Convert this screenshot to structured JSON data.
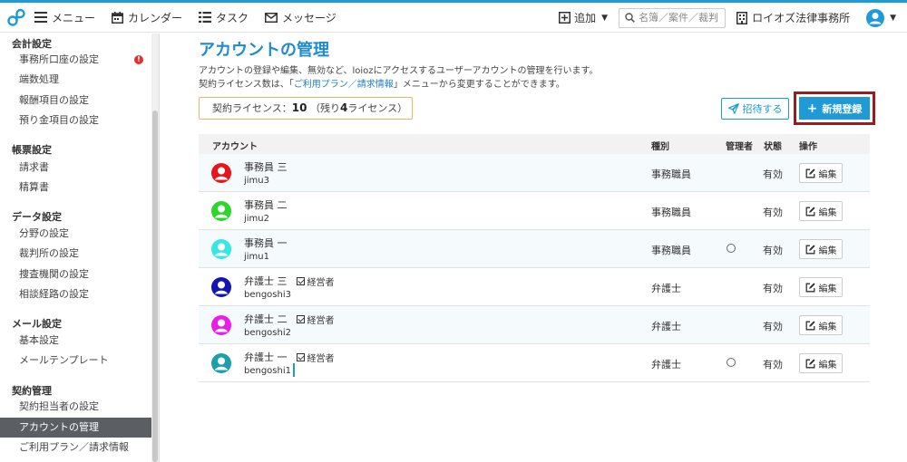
{
  "header": {
    "nav": [
      {
        "label": "メニュー",
        "icon": "hamburger-icon"
      },
      {
        "label": "カレンダー",
        "icon": "calendar-icon"
      },
      {
        "label": "タスク",
        "icon": "list-icon"
      },
      {
        "label": "メッセージ",
        "icon": "mail-icon"
      }
    ],
    "add_label": "追加",
    "search_placeholder": "名簿／案件／裁判",
    "office_name": "ロイオズ法律事務所"
  },
  "sidebar": {
    "groups": [
      {
        "heading": "会計設定",
        "items": [
          "事務所口座の設定",
          "端数処理",
          "報酬項目の設定",
          "預り金項目の設定"
        ]
      },
      {
        "heading": "帳票設定",
        "items": [
          "請求書",
          "精算書"
        ]
      },
      {
        "heading": "データ設定",
        "items": [
          "分野の設定",
          "裁判所の設定",
          "捜査機関の設定",
          "相談経路の設定"
        ]
      },
      {
        "heading": "メール設定",
        "items": [
          "基本設定",
          "メールテンプレート"
        ]
      },
      {
        "heading": "契約管理",
        "items": [
          "契約担当者の設定",
          "アカウントの管理",
          "ご利用プラン／請求情報"
        ]
      }
    ],
    "badge": "!"
  },
  "main": {
    "title": "アカウントの管理",
    "desc_line1": "アカウントの登録や編集、無効など、loiozにアクセスするユーザーアカウントの管理を行います。",
    "desc_line2_pre": "契約ライセンス数は、「",
    "desc_line2_link": "ご利用プラン／請求情報",
    "desc_line2_post": "」メニューから変更することができます。",
    "license_label": "契約ライセンス：",
    "license_count": "10",
    "license_remaining_pre": "（残り",
    "license_remaining": "4",
    "license_remaining_post": "ライセンス）",
    "invite_label": "招待する",
    "new_label": "新規登録"
  },
  "table": {
    "columns": [
      "アカウント",
      "種別",
      "管理者",
      "状態",
      "操作"
    ],
    "owner_label": "経営者",
    "edit_label": "編集",
    "rows": [
      {
        "name": "事務員 三",
        "login": "jimu3",
        "kind": "事務職員",
        "admin": false,
        "owner": false,
        "status": "有効",
        "color": "#e8141c"
      },
      {
        "name": "事務員 二",
        "login": "jimu2",
        "kind": "事務職員",
        "admin": false,
        "owner": false,
        "status": "有効",
        "color": "#2ed52a"
      },
      {
        "name": "事務員 一",
        "login": "jimu1",
        "kind": "事務職員",
        "admin": true,
        "owner": false,
        "status": "有効",
        "color": "#36e7e3"
      },
      {
        "name": "弁護士 三",
        "login": "bengoshi3",
        "kind": "弁護士",
        "admin": false,
        "owner": true,
        "status": "有効",
        "color": "#1414b4"
      },
      {
        "name": "弁護士 二",
        "login": "bengoshi2",
        "kind": "弁護士",
        "admin": false,
        "owner": true,
        "status": "有効",
        "color": "#e81ee8"
      },
      {
        "name": "弁護士 一",
        "login": "bengoshi1",
        "kind": "弁護士",
        "admin": true,
        "owner": true,
        "status": "有効",
        "color": "#1aa0aa"
      }
    ]
  },
  "colors": {
    "accent": "#1e9bd7",
    "highlight_border": "#9b1c1f",
    "license_border": "#f0b36a"
  }
}
